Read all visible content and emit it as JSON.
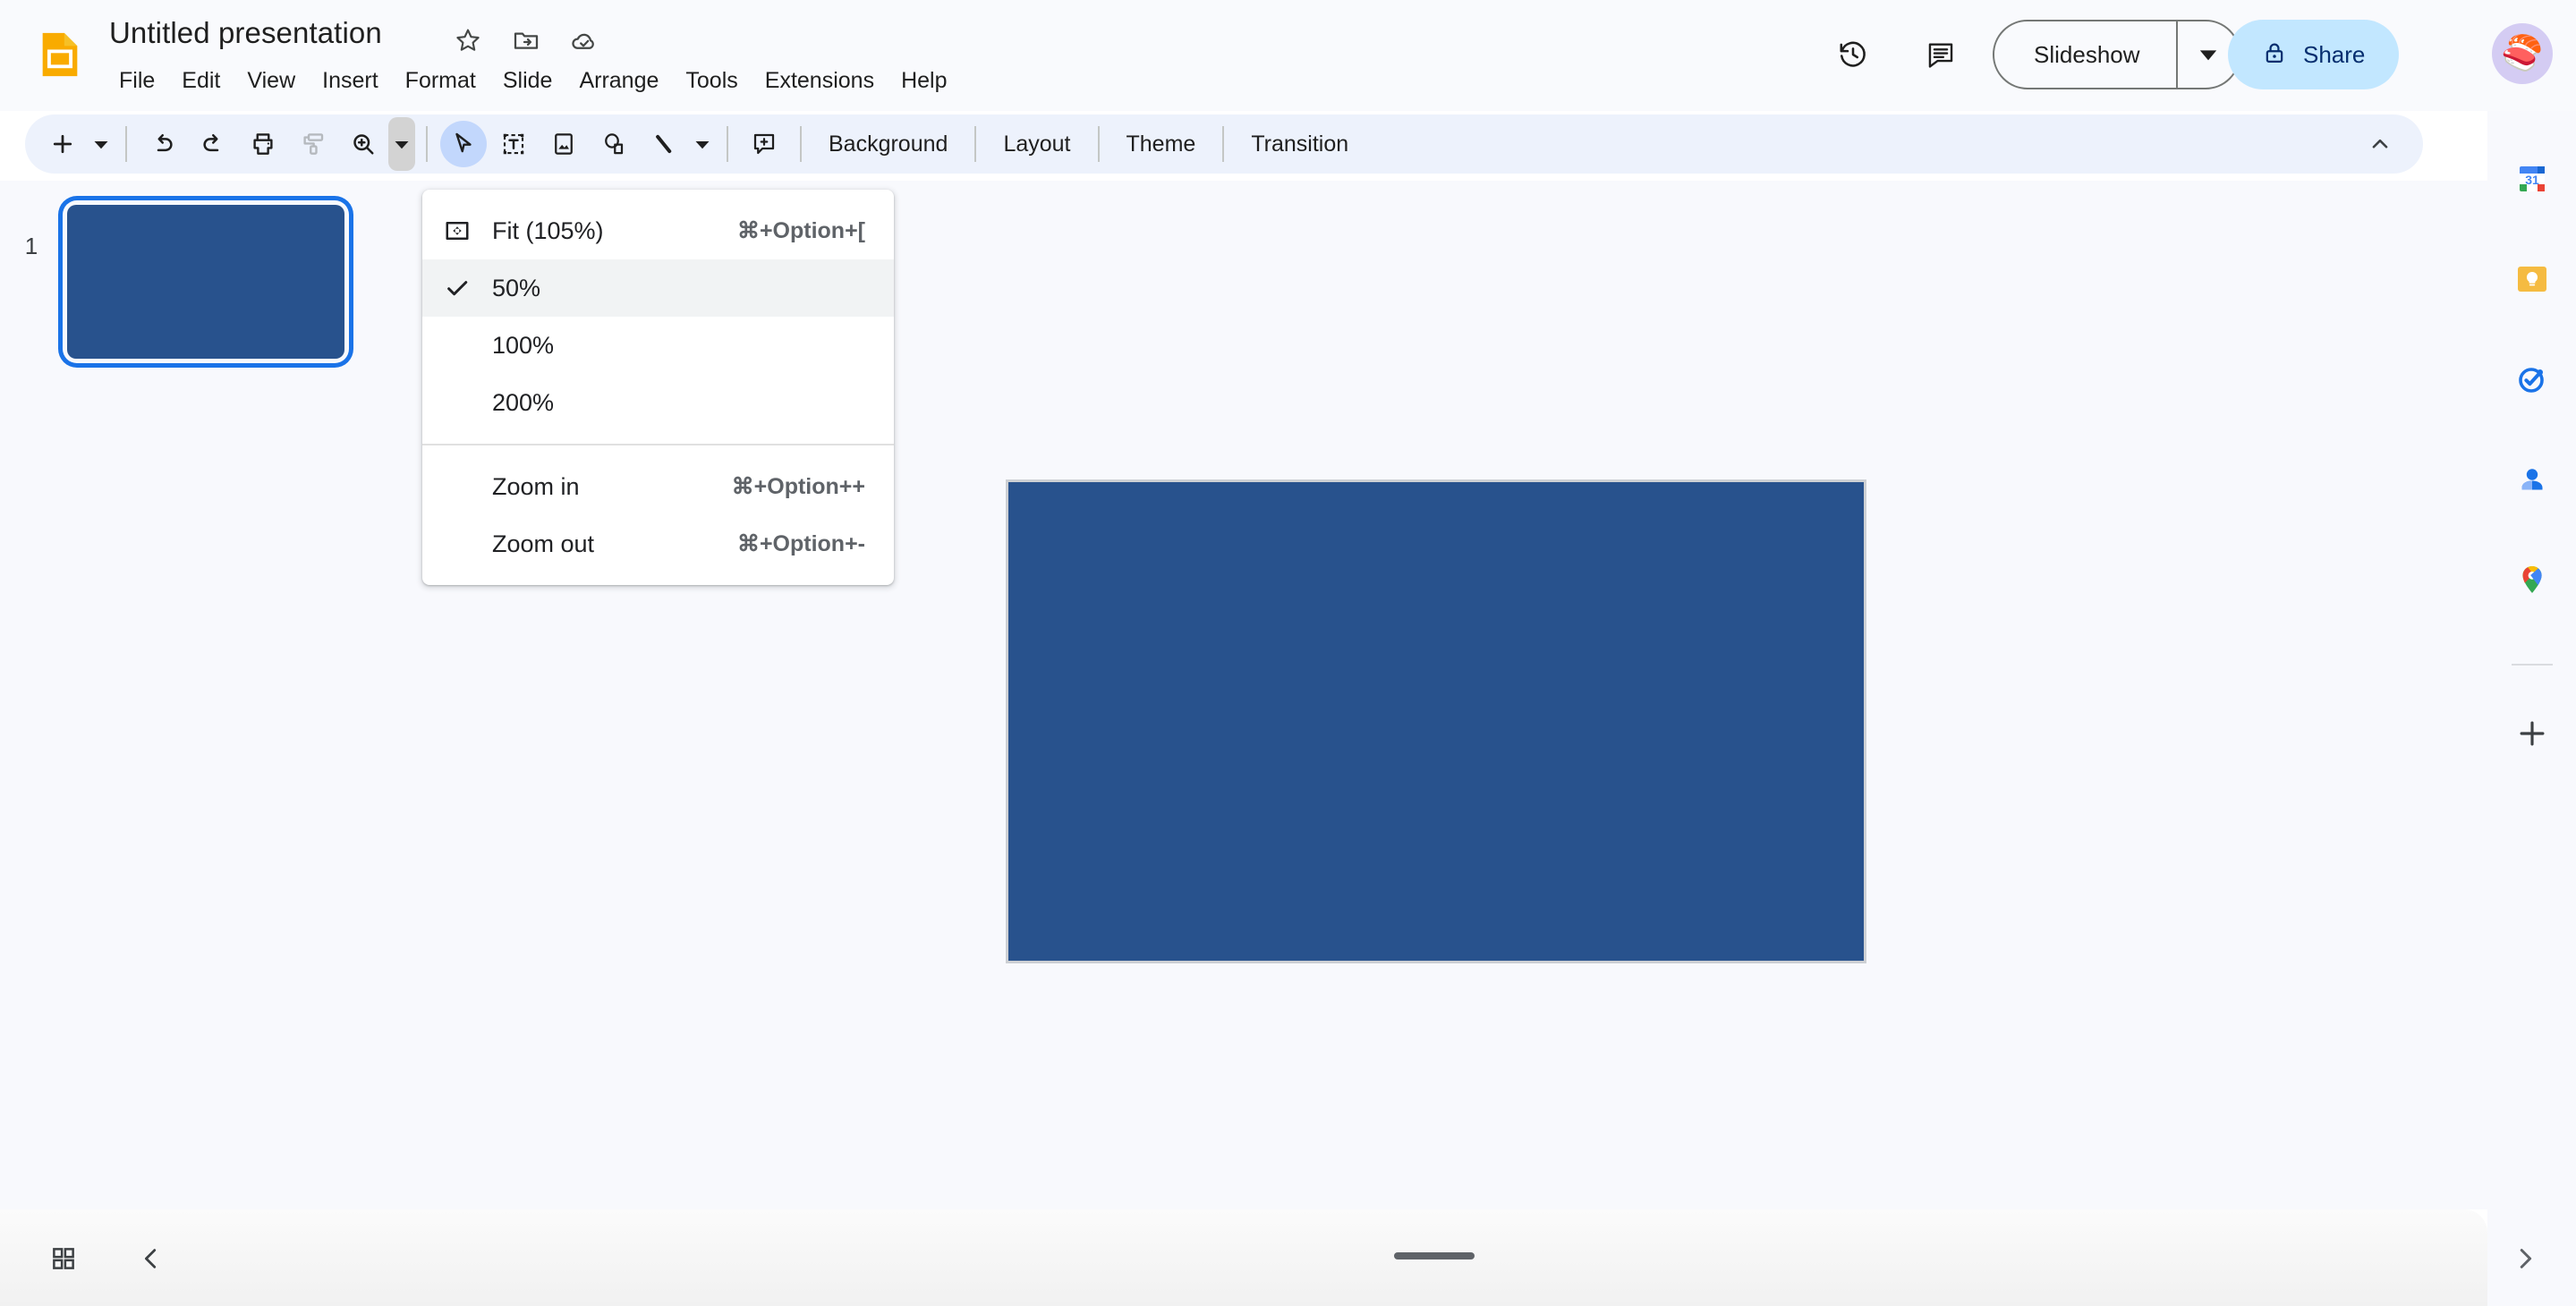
{
  "app": {
    "name": "Google Slides",
    "logo_icon": "slides-logo-icon"
  },
  "header": {
    "title": "Untitled presentation",
    "star_icon": "star-icon",
    "move_icon": "move-to-folder-icon",
    "cloud_icon": "saved-to-drive-cloud-icon",
    "menus": [
      {
        "label": "File"
      },
      {
        "label": "Edit"
      },
      {
        "label": "View"
      },
      {
        "label": "Insert"
      },
      {
        "label": "Format"
      },
      {
        "label": "Slide"
      },
      {
        "label": "Arrange"
      },
      {
        "label": "Tools"
      },
      {
        "label": "Extensions"
      },
      {
        "label": "Help"
      }
    ],
    "history_icon": "version-history-icon",
    "comment_icon": "comment-history-icon",
    "slideshow_label": "Slideshow",
    "slideshow_caret_icon": "chevron-down-icon",
    "share_label": "Share",
    "share_lock_icon": "lock-icon",
    "avatar_emoji": "🍣"
  },
  "toolbar": {
    "new_slide_icon": "add-slide-icon",
    "new_slide_caret_icon": "chevron-down-icon",
    "undo_icon": "undo-icon",
    "redo_icon": "redo-icon",
    "print_icon": "print-icon",
    "paint_format_icon": "paint-format-icon",
    "zoom_icon": "zoom-in-magnifier-icon",
    "zoom_caret_icon": "chevron-down-icon",
    "select_icon": "select-cursor-icon",
    "textbox_icon": "text-box-icon",
    "image_icon": "insert-image-icon",
    "shape_icon": "shape-icon",
    "line_icon": "line-icon",
    "line_caret_icon": "chevron-down-icon",
    "comment_icon": "add-comment-icon",
    "background_label": "Background",
    "layout_label": "Layout",
    "theme_label": "Theme",
    "transition_label": "Transition",
    "collapse_icon": "chevron-up-icon"
  },
  "zoom_menu": {
    "visible": true,
    "items": [
      {
        "label": "Fit (105%)",
        "accel": "⌘+Option+[",
        "lead_icon": "fit-to-screen-icon",
        "checked": false,
        "highlighted": false
      },
      {
        "label": "50%",
        "accel": "",
        "lead_icon": "check-icon",
        "checked": true,
        "highlighted": true
      },
      {
        "label": "100%",
        "accel": "",
        "lead_icon": "",
        "checked": false,
        "highlighted": false
      },
      {
        "label": "200%",
        "accel": "",
        "lead_icon": "",
        "checked": false,
        "highlighted": false
      }
    ],
    "items2": [
      {
        "label": "Zoom in",
        "accel": "⌘+Option++",
        "lead_icon": "",
        "checked": false,
        "highlighted": false
      },
      {
        "label": "Zoom out",
        "accel": "⌘+Option+-",
        "lead_icon": "",
        "checked": false,
        "highlighted": false
      }
    ]
  },
  "filmstrip": {
    "slides": [
      {
        "number": "1",
        "selected": true,
        "fill_color": "#28528d"
      }
    ]
  },
  "canvas": {
    "slide_fill_color": "#28528d",
    "border_color": "#cdd0d4"
  },
  "right_rail": {
    "items": [
      {
        "name": "google-calendar-icon",
        "label": "Calendar",
        "day": "31"
      },
      {
        "name": "google-keep-icon",
        "label": "Keep"
      },
      {
        "name": "google-tasks-icon",
        "label": "Tasks"
      },
      {
        "name": "google-contacts-icon",
        "label": "Contacts"
      },
      {
        "name": "google-maps-icon",
        "label": "Maps"
      },
      {
        "name": "add-ons-icon",
        "label": "Get Add-ons"
      }
    ]
  },
  "bottom_bar": {
    "grid_icon": "grid-view-icon",
    "prev_icon": "chevron-left-icon",
    "next_icon": "chevron-right-icon",
    "notes_handle": "speaker-notes-drag-handle"
  },
  "colors": {
    "accent_blue": "#1a73e8",
    "slide_blue": "#28528d",
    "toolbar_bg": "#edf2fc",
    "share_bg": "#c2e7ff",
    "workspace_bg": "#f8f9fd"
  }
}
